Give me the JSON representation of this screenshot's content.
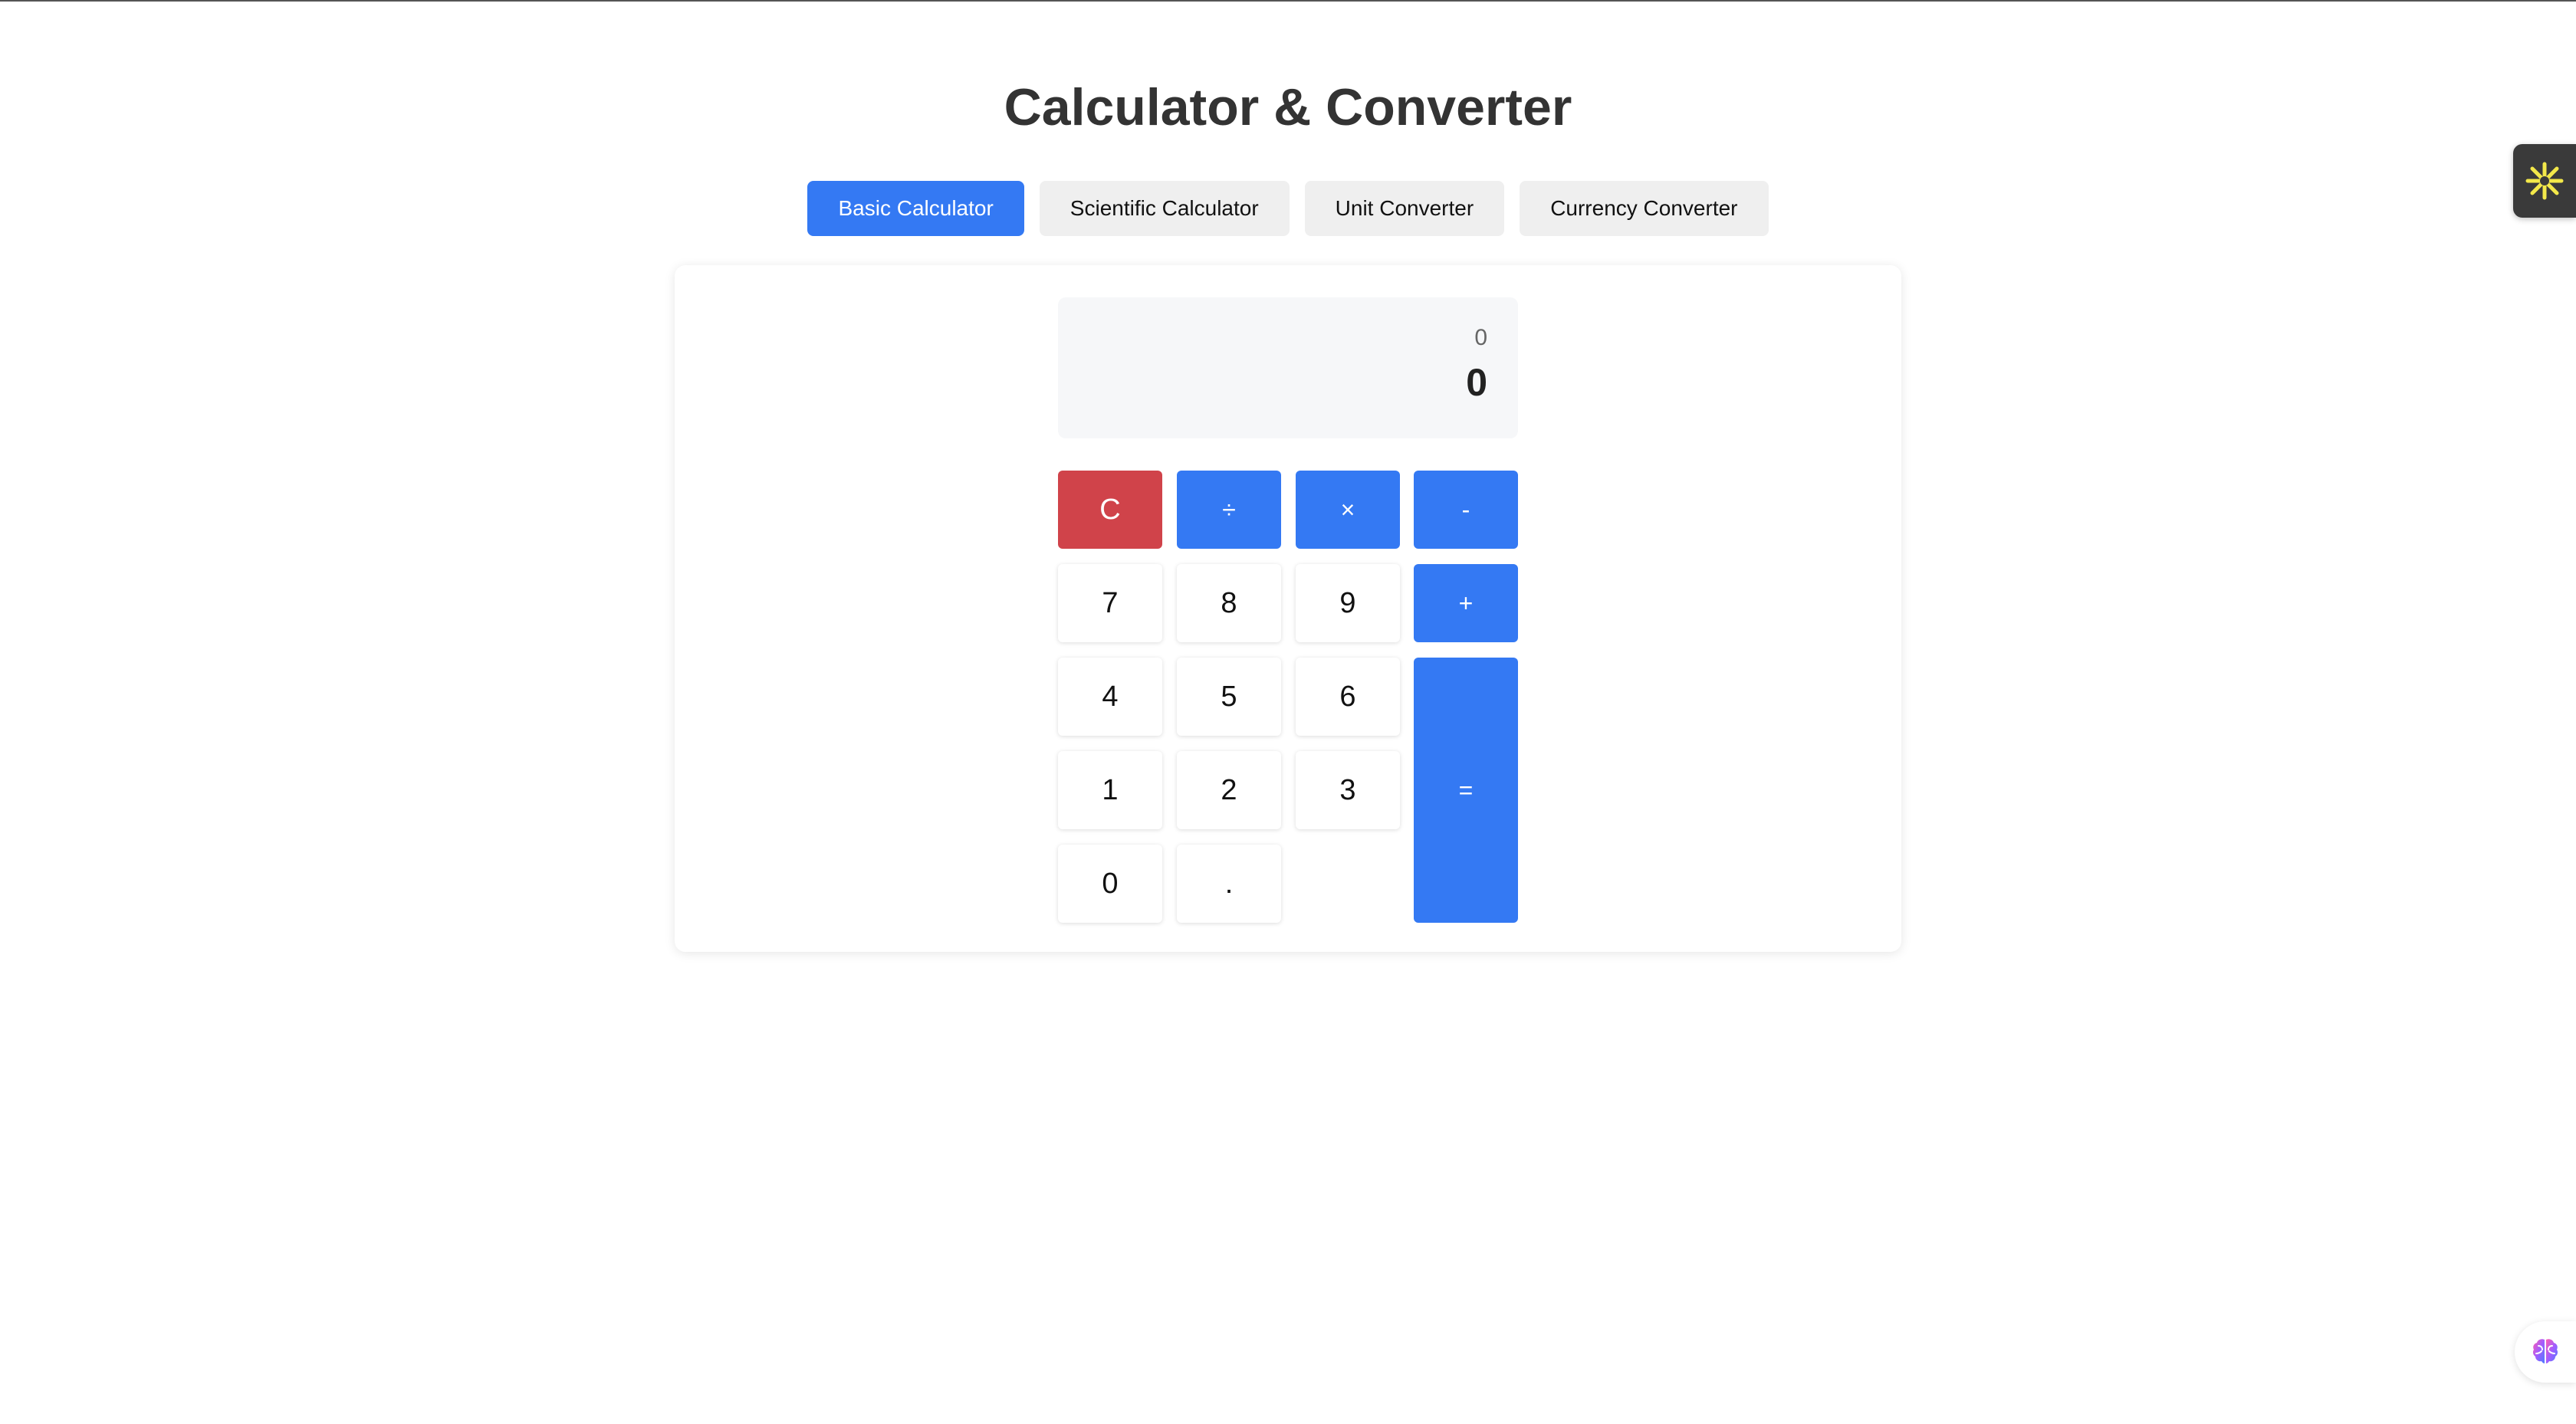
{
  "page": {
    "title": "Calculator & Converter"
  },
  "tabs": [
    {
      "label": "Basic Calculator",
      "active": true
    },
    {
      "label": "Scientific Calculator",
      "active": false
    },
    {
      "label": "Unit Converter",
      "active": false
    },
    {
      "label": "Currency Converter",
      "active": false
    }
  ],
  "display": {
    "expression": "0",
    "result": "0"
  },
  "keys": {
    "clear": "C",
    "divide": "÷",
    "multiply": "×",
    "subtract": "-",
    "add": "+",
    "equals": "=",
    "seven": "7",
    "eight": "8",
    "nine": "9",
    "four": "4",
    "five": "5",
    "six": "6",
    "one": "1",
    "two": "2",
    "three": "3",
    "zero": "0",
    "decimal": "."
  },
  "colors": {
    "accent": "#3479f3",
    "clear": "#d0434a",
    "extension_icon": "#f3e84a"
  },
  "widgets": {
    "side_extension_icon": "sparkle-icon",
    "assistant_icon": "brain-icon"
  }
}
